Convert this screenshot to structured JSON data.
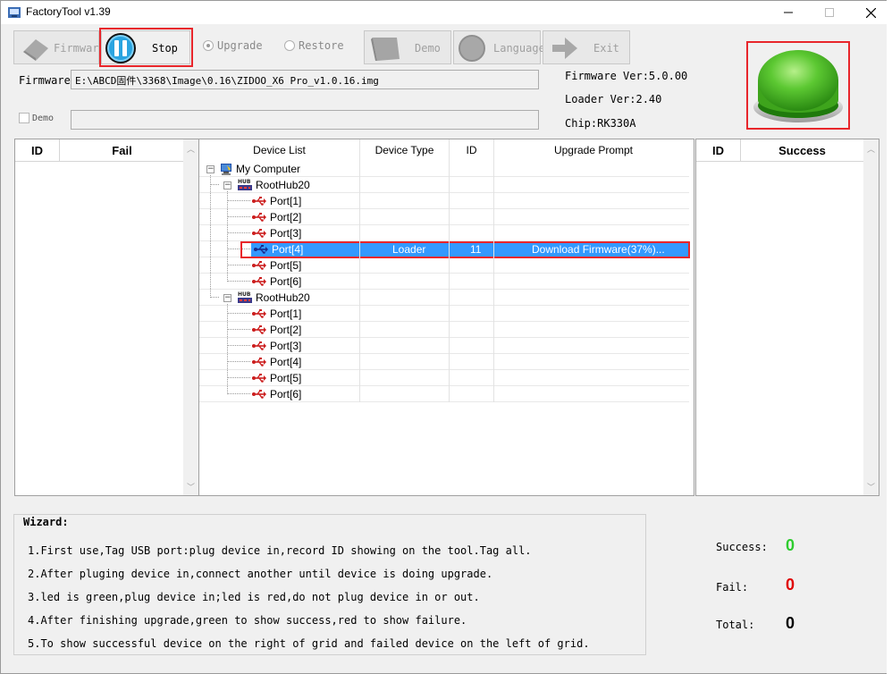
{
  "window": {
    "title": "FactoryTool v1.39"
  },
  "toolbar": {
    "firmware_label": "Firmware",
    "stop_label": "Stop",
    "upgrade_label": "Upgrade",
    "restore_label": "Restore",
    "demo_label": "Demo",
    "language_label": "Language",
    "exit_label": "Exit"
  },
  "firmware": {
    "label": "Firmware",
    "path": "E:\\ABCD固件\\3368\\Image\\0.16\\ZIDOO_X6 Pro_v1.0.16.img"
  },
  "demo": {
    "label": "Demo",
    "value": ""
  },
  "info": {
    "firmware_ver": "Firmware Ver:5.0.00",
    "loader_ver": "Loader Ver:2.40",
    "chip": "Chip:RK330A"
  },
  "fail_panel": {
    "col_id": "ID",
    "col_fail": "Fail"
  },
  "success_panel": {
    "col_id": "ID",
    "col_success": "Success"
  },
  "device_table": {
    "headers": [
      "Device List",
      "Device Type",
      "ID",
      "Upgrade Prompt"
    ],
    "root": "My Computer",
    "hubs": [
      {
        "badge": "HUB",
        "name": "RootHub20",
        "ports": [
          {
            "name": "Port[1]",
            "type": "",
            "id": "",
            "prompt": ""
          },
          {
            "name": "Port[2]",
            "type": "",
            "id": "",
            "prompt": ""
          },
          {
            "name": "Port[3]",
            "type": "",
            "id": "",
            "prompt": ""
          },
          {
            "name": "Port[4]",
            "type": "Loader",
            "id": "11",
            "prompt": "Download Firmware(37%)..."
          },
          {
            "name": "Port[5]",
            "type": "",
            "id": "",
            "prompt": ""
          },
          {
            "name": "Port[6]",
            "type": "",
            "id": "",
            "prompt": ""
          }
        ]
      },
      {
        "badge": "HUB",
        "name": "RootHub20",
        "ports": [
          {
            "name": "Port[1]"
          },
          {
            "name": "Port[2]"
          },
          {
            "name": "Port[3]"
          },
          {
            "name": "Port[4]"
          },
          {
            "name": "Port[5]"
          },
          {
            "name": "Port[6]"
          }
        ]
      }
    ]
  },
  "wizard": {
    "title": "Wizard:",
    "lines": [
      "1.First use,Tag USB port:plug device in,record ID showing on the tool.Tag all.",
      "2.After pluging device in,connect another until device is doing upgrade.",
      "3.led is green,plug device in;led is red,do not plug device in or out.",
      "4.After finishing upgrade,green to show success,red to show failure.",
      "5.To show successful device on the right of grid and failed device on the left of grid."
    ]
  },
  "stats": {
    "success_label": "Success:",
    "success_value": "0",
    "fail_label": "Fail:",
    "fail_value": "0",
    "total_label": "Total:",
    "total_value": "0"
  },
  "colors": {
    "selection": "#3399ff",
    "highlight_box": "#e8262b",
    "success": "#2ecc2e",
    "fail": "#e00000",
    "status_led": "#5cc832"
  }
}
